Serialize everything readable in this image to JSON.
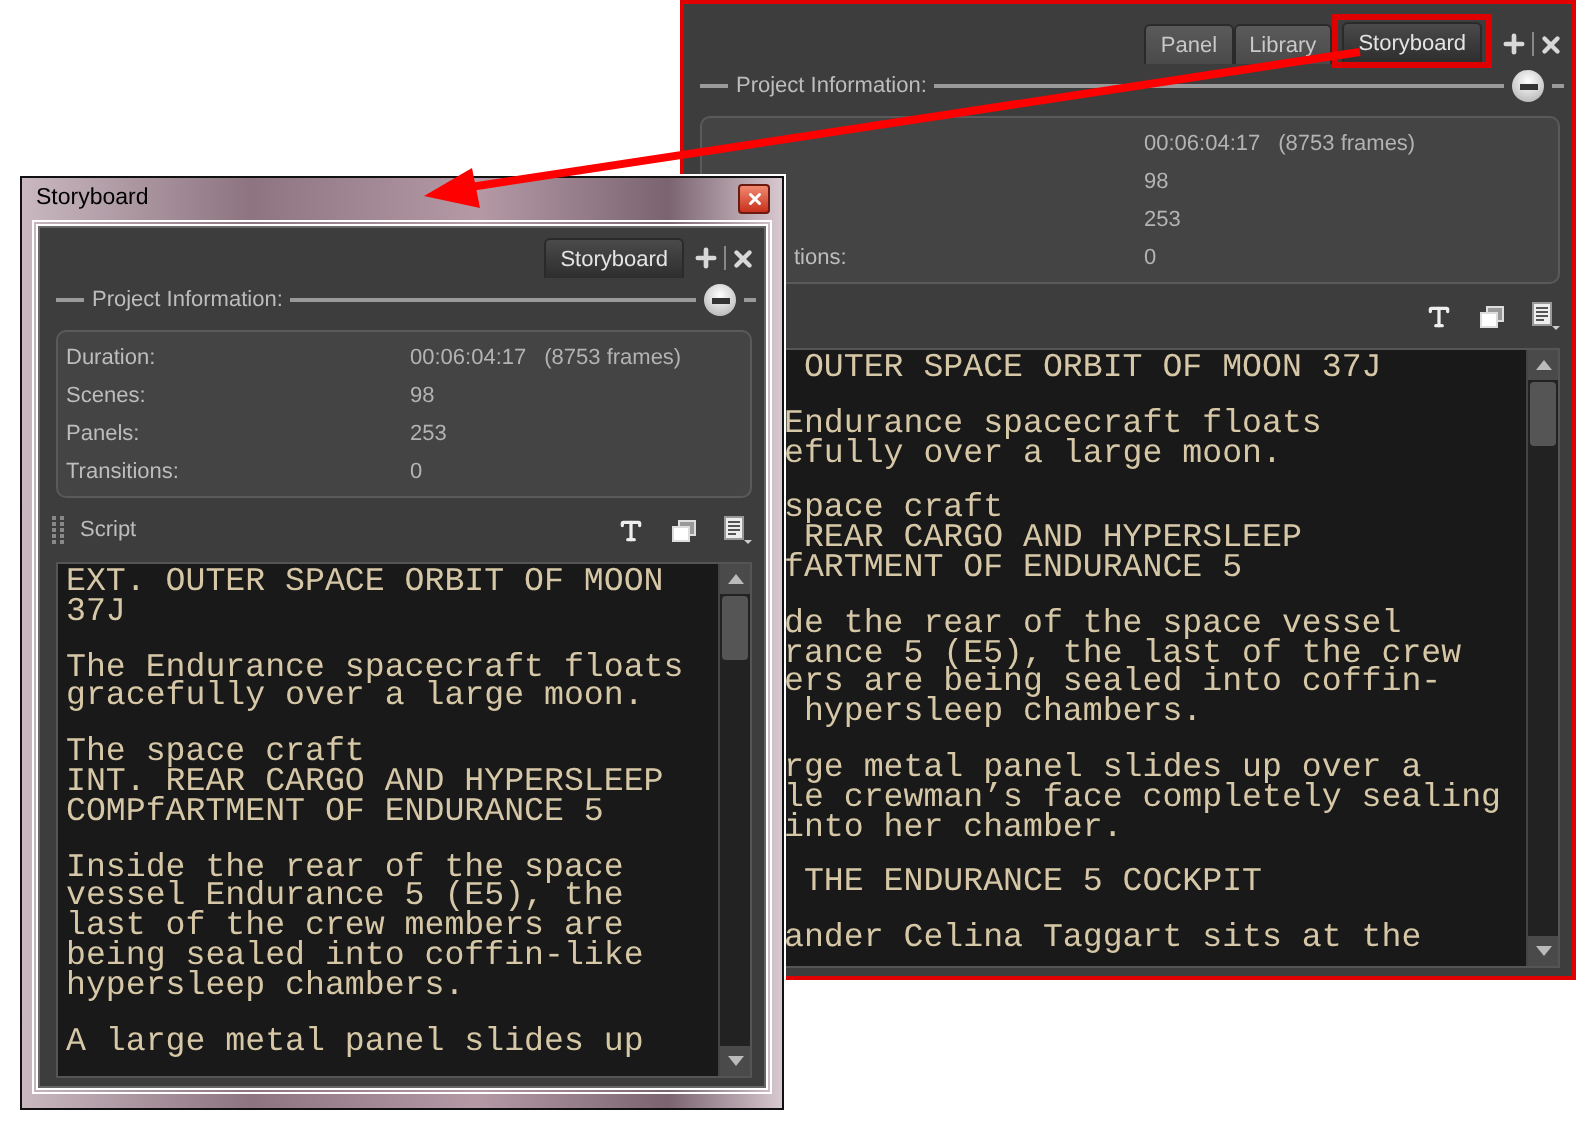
{
  "docked_panel": {
    "tabs": [
      {
        "label": "Panel",
        "selected": false,
        "highlighted": false
      },
      {
        "label": "Library",
        "selected": false,
        "highlighted": false
      },
      {
        "label": "Storyboard",
        "selected": true,
        "highlighted": true
      }
    ],
    "section_title": "Project Information:",
    "info": [
      {
        "value": "00:06:04:17",
        "note": "(8753 frames)"
      },
      {
        "value": "98"
      },
      {
        "value": "253"
      },
      {
        "label": "tions:",
        "cut": true,
        "value": "0"
      }
    ],
    "script": [
      [
        " OUTER SPACE ORBIT OF MOON 37J"
      ],
      [
        "Endurance spacecraft floats",
        "efully over a large moon."
      ],
      [
        "space craft",
        " REAR CARGO AND HYPERSLEEP",
        "fARTMENT OF ENDURANCE 5"
      ],
      [
        "de the rear of the space vessel",
        "rance 5 (E5), the last of the crew",
        "ers are being sealed into coffin-",
        " hypersleep chambers."
      ],
      [
        "rge metal panel slides up over a",
        "le crewman’s face completely sealing",
        "into her chamber."
      ],
      [
        " THE ENDURANCE 5 COCKPIT"
      ],
      [
        "ander Celina Taggart sits at the"
      ]
    ]
  },
  "floating_window": {
    "title": "Storyboard",
    "tabs": [
      {
        "label": "Storyboard",
        "selected": true,
        "highlighted": false
      }
    ],
    "section_title": "Project Information:",
    "info": [
      {
        "label": "Duration:",
        "value": "00:06:04:17",
        "note": "(8753 frames)"
      },
      {
        "label": "Scenes:",
        "value": "98"
      },
      {
        "label": "Panels:",
        "value": "253"
      },
      {
        "label": "Transitions:",
        "value": "0"
      }
    ],
    "script_label": "Script",
    "script": [
      [
        "EXT. OUTER SPACE ORBIT OF MOON",
        "37J"
      ],
      [
        "The Endurance spacecraft floats",
        "gracefully over a large moon."
      ],
      [
        "The space craft",
        "INT. REAR CARGO AND HYPERSLEEP",
        "COMPfARTMENT OF ENDURANCE 5"
      ],
      [
        "Inside the rear of the space",
        "vessel Endurance 5 (E5), the",
        "last of the crew members are",
        "being sealed into coffin-like",
        "hypersleep chambers."
      ],
      [
        "A large metal panel slides up"
      ]
    ]
  }
}
